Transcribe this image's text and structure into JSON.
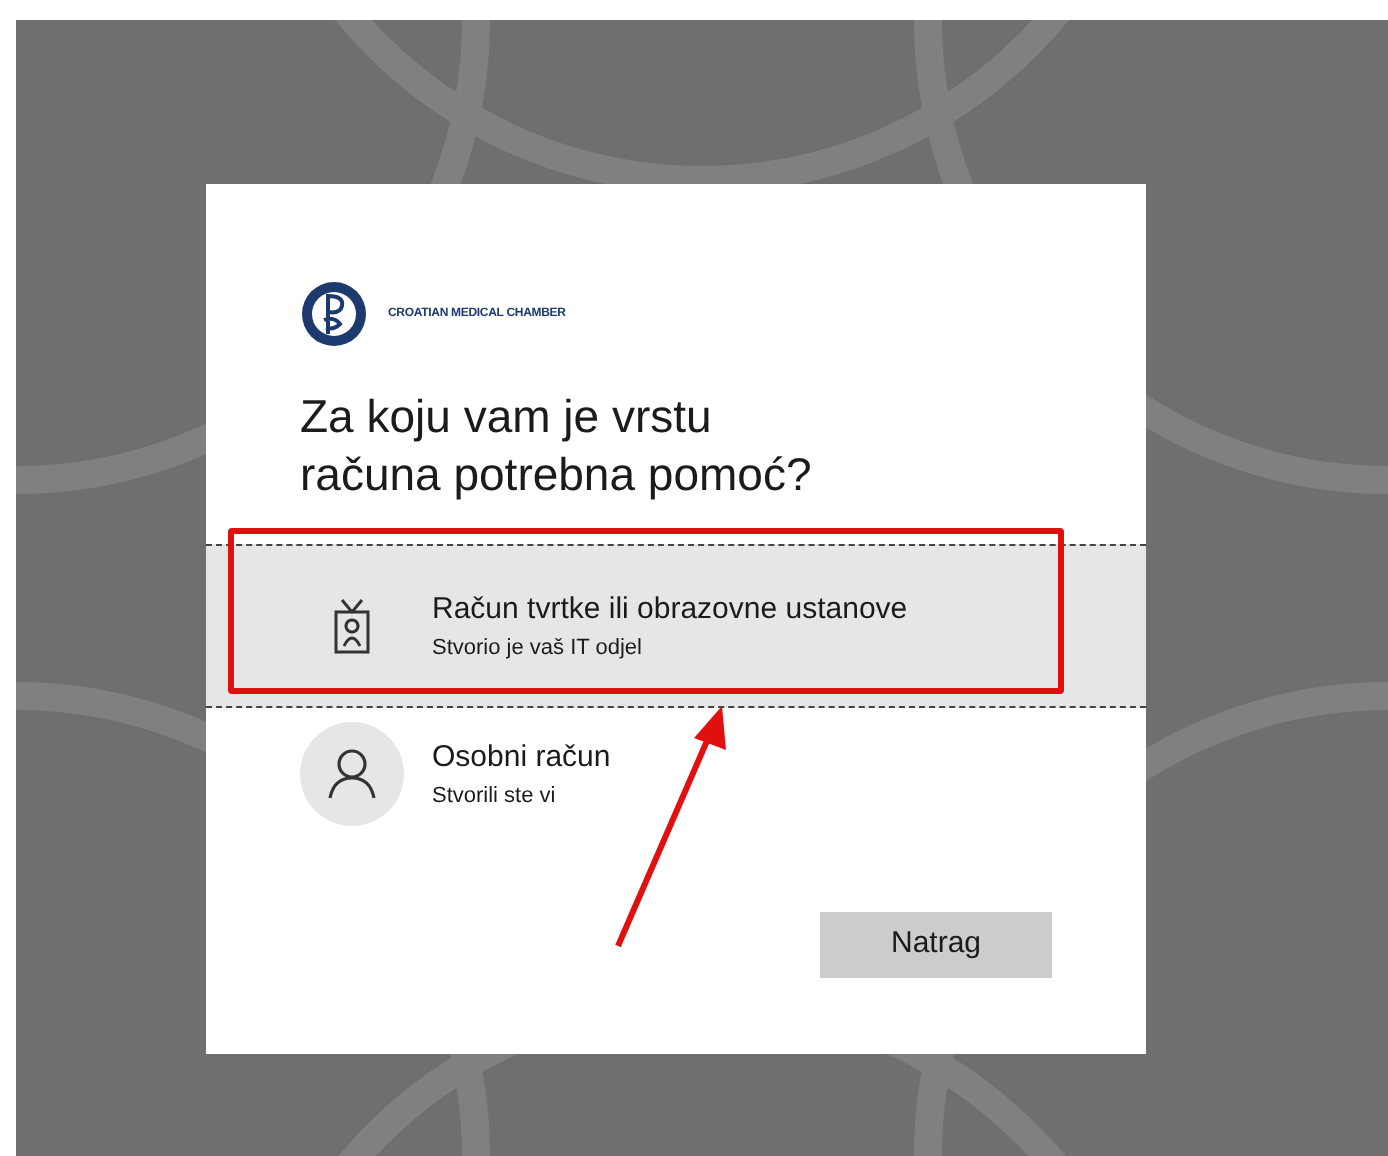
{
  "logo": {
    "text": "CROATIAN MEDICAL CHAMBER"
  },
  "heading": "Za koju vam je vrstu računa potrebna pomoć?",
  "options": [
    {
      "kind": "work",
      "title": "Račun tvrtke ili obrazovne ustanove",
      "subtitle": "Stvorio je vaš IT odjel",
      "selected": true
    },
    {
      "kind": "personal",
      "title": "Osobni račun",
      "subtitle": "Stvorili ste vi",
      "selected": false
    }
  ],
  "back_button": "Natrag"
}
